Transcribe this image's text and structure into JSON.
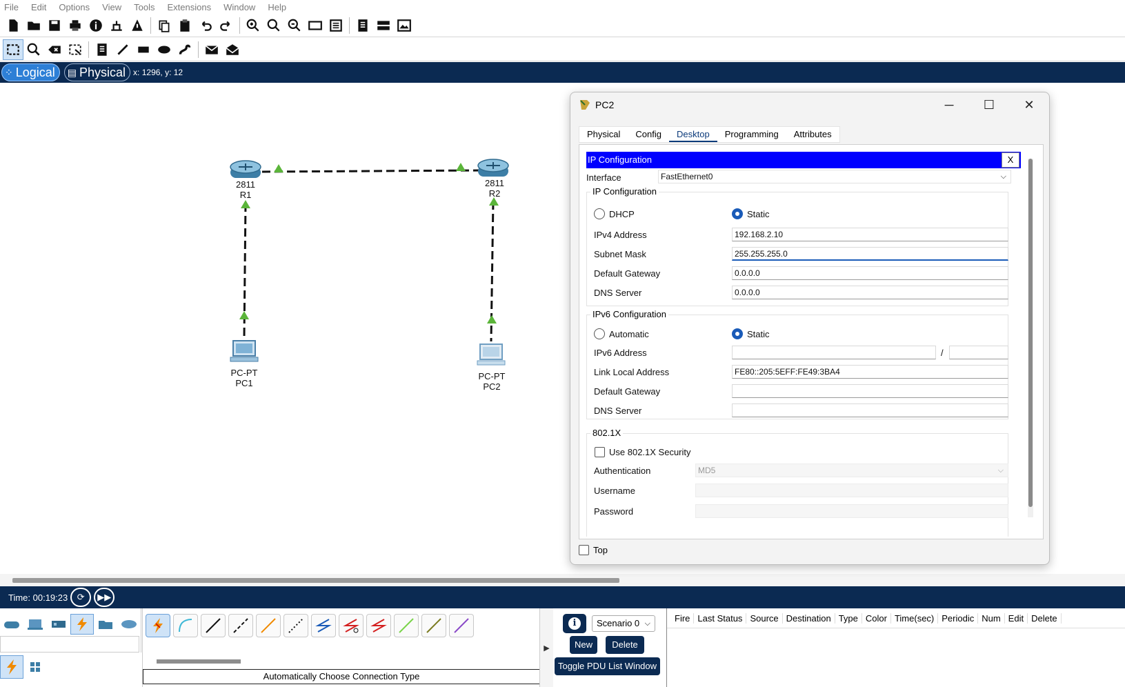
{
  "menu": [
    "File",
    "Edit",
    "Options",
    "View",
    "Tools",
    "Extensions",
    "Window",
    "Help"
  ],
  "modebar": {
    "logical": "Logical",
    "physical": "Physical",
    "coords": "x: 1296, y: 12"
  },
  "topology": {
    "routers": [
      {
        "model": "2811",
        "name": "R1"
      },
      {
        "model": "2811",
        "name": "R2"
      }
    ],
    "pcs": [
      {
        "model": "PC-PT",
        "name": "PC1"
      },
      {
        "model": "PC-PT",
        "name": "PC2"
      }
    ],
    "link_status_color": "#5bb53a"
  },
  "timebar": {
    "time": "Time: 00:19:23"
  },
  "bottom": {
    "connection_status": "Automatically Choose Connection Type",
    "scenario": "Scenario 0",
    "new_label": "New",
    "delete_label": "Delete",
    "toggle_label": "Toggle PDU List Window",
    "pdu_columns": [
      "Fire",
      "Last Status",
      "Source",
      "Destination",
      "Type",
      "Color",
      "Time(sec)",
      "Periodic",
      "Num",
      "Edit",
      "Delete"
    ]
  },
  "dialog": {
    "title": "PC2",
    "tabs": [
      "Physical",
      "Config",
      "Desktop",
      "Programming",
      "Attributes"
    ],
    "active_tab": "Desktop",
    "ip_bar": "IP Configuration",
    "close_x": "X",
    "interface_label": "Interface",
    "interface_value": "FastEthernet0",
    "ipv4": {
      "group": "IP Configuration",
      "dhcp": "DHCP",
      "static": "Static",
      "ipv4_label": "IPv4 Address",
      "ipv4_value": "192.168.2.10",
      "mask_label": "Subnet Mask",
      "mask_value": "255.255.255.0",
      "gw_label": "Default Gateway",
      "gw_value": "0.0.0.0",
      "dns_label": "DNS Server",
      "dns_value": "0.0.0.0"
    },
    "ipv6": {
      "group": "IPv6 Configuration",
      "automatic": "Automatic",
      "static": "Static",
      "addr_label": "IPv6 Address",
      "addr_value": "",
      "slash": "/",
      "ll_label": "Link Local Address",
      "ll_value": "FE80::205:5EFF:FE49:3BA4",
      "gw_label": "Default Gateway",
      "dns_label": "DNS Server"
    },
    "dot1x": {
      "group": "802.1X",
      "use_label": "Use 802.1X Security",
      "auth_label": "Authentication",
      "auth_value": "MD5",
      "user_label": "Username",
      "pass_label": "Password"
    },
    "top_label": "Top"
  },
  "colors": {
    "navy": "#0b2a52",
    "ip_bar": "#0000ff",
    "accent": "#1a5bb8"
  }
}
